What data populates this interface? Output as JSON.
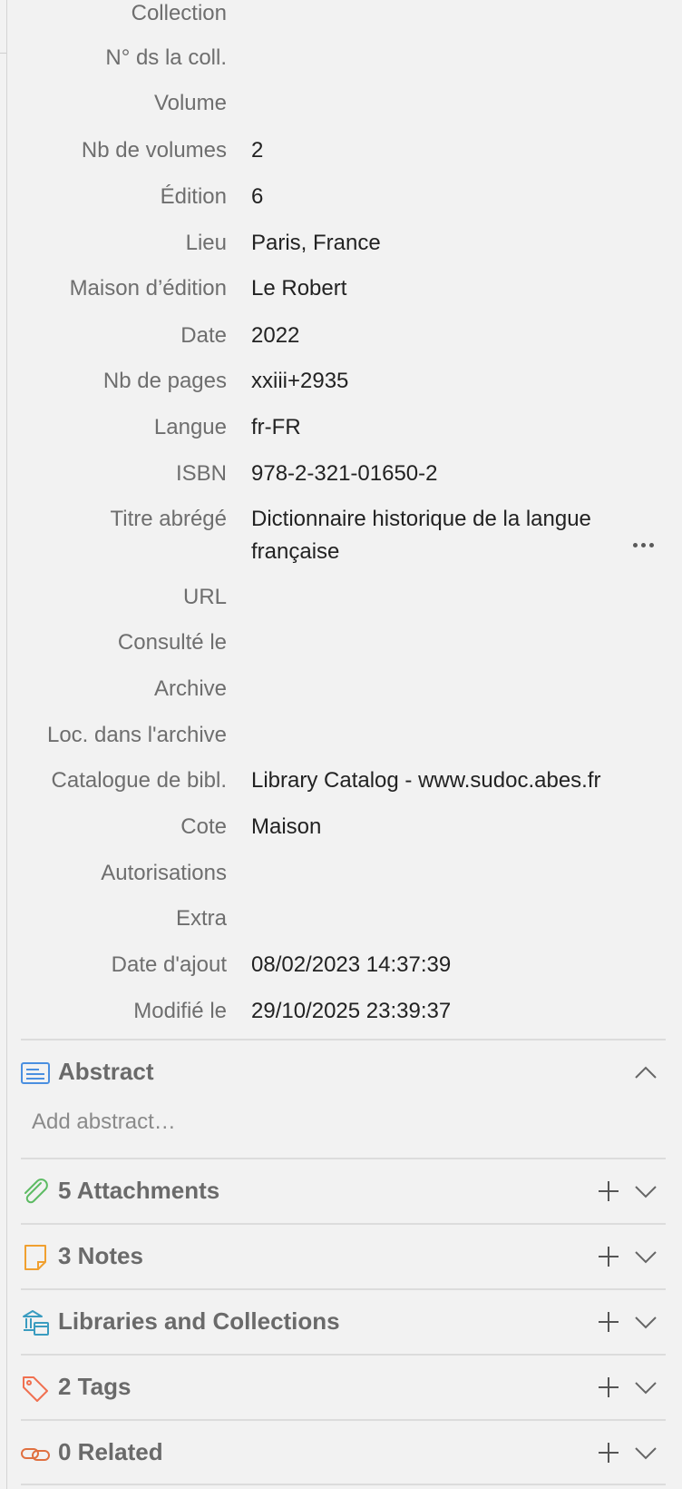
{
  "fields": [
    {
      "label": "Collection",
      "value": ""
    },
    {
      "label": "N° ds la coll.",
      "value": ""
    },
    {
      "label": "Volume",
      "value": ""
    },
    {
      "label": "Nb de volumes",
      "value": "2"
    },
    {
      "label": "Édition",
      "value": "6"
    },
    {
      "label": "Lieu",
      "value": "Paris, France"
    },
    {
      "label": "Maison d’édition",
      "value": "Le Robert"
    },
    {
      "label": "Date",
      "value": "2022"
    },
    {
      "label": "Nb de pages",
      "value": "xxiii+2935"
    },
    {
      "label": "Langue",
      "value": "fr-FR"
    },
    {
      "label": "ISBN",
      "value": "978-2-321-01650-2"
    },
    {
      "label": "Titre abrégé",
      "value": "Dictionnaire historique de la langue française"
    },
    {
      "label": "URL",
      "value": ""
    },
    {
      "label": "Consulté le",
      "value": ""
    },
    {
      "label": "Archive",
      "value": ""
    },
    {
      "label": "Loc. dans l'archive",
      "value": ""
    },
    {
      "label": "Catalogue de bibl.",
      "value": "Library Catalog - www.sudoc.abes.fr"
    },
    {
      "label": "Cote",
      "value": "Maison"
    },
    {
      "label": "Autorisations",
      "value": ""
    },
    {
      "label": "Extra",
      "value": ""
    },
    {
      "label": "Date d'ajout",
      "value": "08/02/2023 14:37:39"
    },
    {
      "label": "Modifié le",
      "value": "29/10/2025 23:39:37"
    }
  ],
  "abstract": {
    "title": "Abstract",
    "placeholder": "Add abstract…"
  },
  "sections": {
    "attachments": "5 Attachments",
    "notes": "3 Notes",
    "libraries": "Libraries and Collections",
    "tags": "2 Tags",
    "related": "0 Related"
  },
  "colors": {
    "abstract_icon": "#4a8fe0",
    "attachments_icon": "#5dbb63",
    "notes_icon": "#f0a030",
    "libraries_icon": "#3a9cc0",
    "tags_icon": "#f07050",
    "related_icon": "#e07040"
  }
}
